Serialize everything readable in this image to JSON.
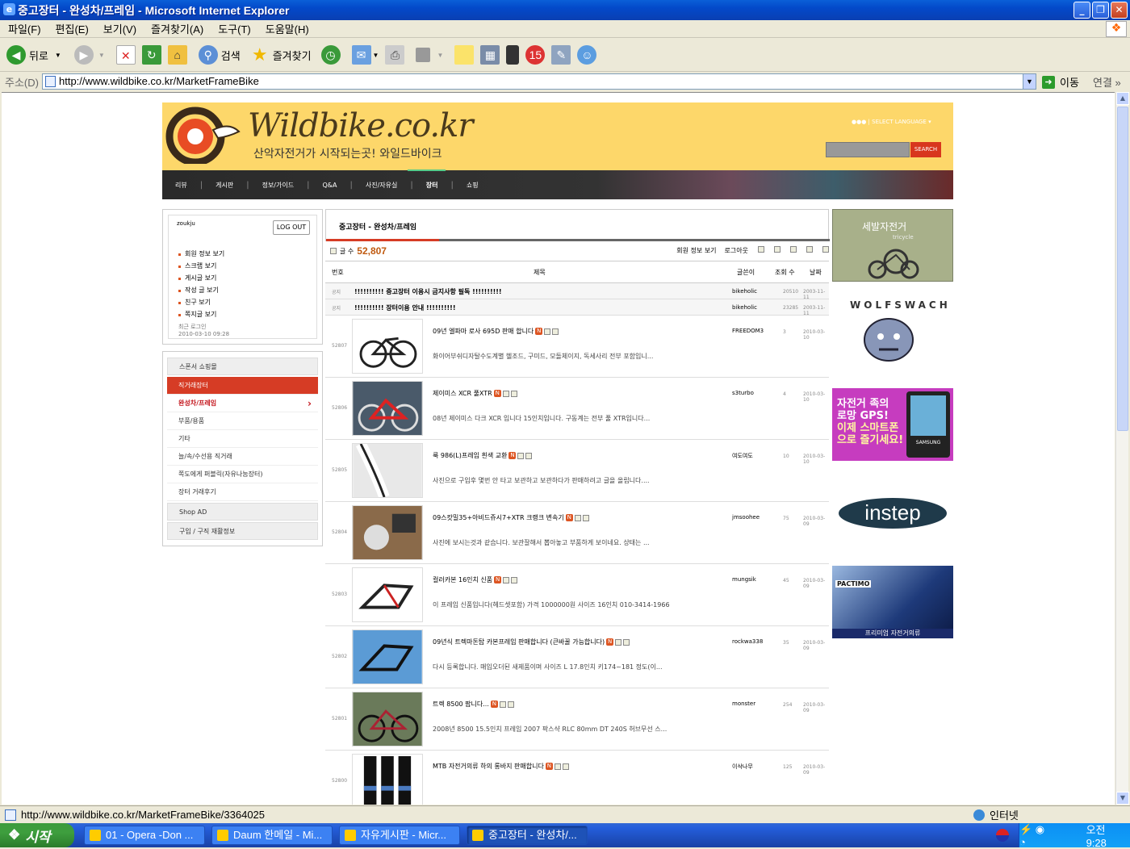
{
  "window": {
    "title": "중고장터 - 완성차/프레임 - Microsoft Internet Explorer",
    "controls": {
      "minimize": "_",
      "restore": "❐",
      "close": "✕"
    }
  },
  "menu": [
    "파일(F)",
    "편집(E)",
    "보기(V)",
    "즐겨찾기(A)",
    "도구(T)",
    "도움말(H)"
  ],
  "toolbar": {
    "back": "뒤로",
    "search": "검색",
    "favorites": "즐겨찾기"
  },
  "address": {
    "label": "주소(D)",
    "url": "http://www.wildbike.co.kr/MarketFrameBike",
    "go": "이동",
    "links": "연결"
  },
  "status": {
    "url": "http://www.wildbike.co.kr/MarketFrameBike/3364025",
    "zone": "인터넷"
  },
  "taskbar": {
    "start": "시작",
    "tasks": [
      "01 - Opera -Don ...",
      "Daum 한메일 - Mi...",
      "자유게시판 - Micr...",
      "중고장터 - 완성차/..."
    ],
    "clock": "오전 9:28"
  },
  "site": {
    "logo": "Wildbike.co.kr",
    "slogan": "산악자전거가 시작되는곳! 와일드바이크",
    "lang_toggle": "●●● | SELECT LANGUAGE ▾",
    "search_button": "SEARCH",
    "nav": [
      "리뷰",
      "게시판",
      "정보/가이드",
      "Q&A",
      "사진/자유실",
      "장터",
      "쇼핑"
    ]
  },
  "login": {
    "user": "zoukju",
    "logout": "LOG OUT",
    "links": [
      "회원 정보 보기",
      "스크랩 보기",
      "게시글 보기",
      "작성 글 보기",
      "친구 보기",
      "쪽지글 보기"
    ],
    "recent_label": "최근 로그인",
    "recent_time": "2010-03-10 09:28"
  },
  "categories": [
    {
      "label": "스폰서 쇼핑몰",
      "style": "head"
    },
    {
      "label": "직거래장터",
      "style": "red"
    },
    {
      "label": "완성차/프레임",
      "style": "redtxt"
    },
    {
      "label": "부품/용품",
      "style": ""
    },
    {
      "label": "기타",
      "style": ""
    },
    {
      "label": "늘/속/수선용 직거래",
      "style": ""
    },
    {
      "label": "쪽도에게 퍼블릭(자유나눔장터)",
      "style": ""
    },
    {
      "label": "장터 거래후기",
      "style": ""
    },
    {
      "label": "Shop AD",
      "style": "head"
    },
    {
      "label": "구입 / 구직 재활정보",
      "style": "head"
    }
  ],
  "board": {
    "tab": "중고장터 - 완성차/프레임",
    "count_label": "글 수",
    "count": "52,807",
    "tools": [
      "회원 정보 보기",
      "로그아웃"
    ],
    "headers": {
      "no": "번호",
      "title": "제목",
      "writer": "글쓴이",
      "views": "조회 수",
      "date": "날짜"
    },
    "notices": [
      {
        "no": "공지",
        "title": "!!!!!!!!!! 중고장터 이용시 금지사항 필독 !!!!!!!!!!",
        "writer": "bikeholic",
        "views": "20510",
        "date": "2003-11-11"
      },
      {
        "no": "공지",
        "title": "!!!!!!!!!! 장터이용 안내 !!!!!!!!!!",
        "writer": "bikeholic",
        "views": "23285",
        "date": "2003-11-11"
      }
    ],
    "items": [
      {
        "no": "52807",
        "title": "09년 엘파마 로사 695D 판매 합니다",
        "sub": "화이어부쉬디자탈수도계별 헬조드, 구미드, 모돌체이지, 독세사리 전부 포함입니...",
        "writer": "FREEDOM3",
        "views": "3",
        "date": "2010-03-10",
        "thumb": "bike-black"
      },
      {
        "no": "52806",
        "title": "제이미스 XCR 풀XTR",
        "sub": "08년 제이미스 다크 XCR 입니다 15인치입니다. 구동계는 전부 풀 XTR입니다...",
        "writer": "s3turbo",
        "views": "4",
        "date": "2010-03-10",
        "thumb": "bike-red"
      },
      {
        "no": "52805",
        "title": "룩 986(L)프레임 흰색 교환",
        "sub": "사진으로 구입후 몇번 안 타고 보관하고 보관하다가 판매하려고 글을 올립니다....",
        "writer": "여도여도",
        "views": "10",
        "date": "2010-03-10",
        "thumb": "frame-white"
      },
      {
        "no": "52804",
        "title": "09스캇밀35+아비드쥬시7+XTR 크랭크 변속기",
        "sub": "사진에 보시는것과 같습니다. 보관잘해서 뽑아놓고 부품하게 보이네요. 상태는 ...",
        "writer": "jmsoohee",
        "views": "75",
        "date": "2010-03-09",
        "thumb": "parts"
      },
      {
        "no": "52803",
        "title": "컬러카본 16인치 신품",
        "sub": "이 프레임 신품입니다(헤드셋포함) 가격 1000000원 사이즈 16인치 010-3414-1966",
        "writer": "mungsik",
        "views": "45",
        "date": "2010-03-09",
        "thumb": "frame-black"
      },
      {
        "no": "52802",
        "title": "09년식 트렉마돈탑 카본프레임 판매합니다 (큰바꿀 가능합니다)",
        "sub": "다시 등록합니다. 매입오더된 새제품이며 사이즈 L 17.8인치 키174~181 정도(이...",
        "writer": "rockwa338",
        "views": "35",
        "date": "2010-03-09",
        "thumb": "frame-blue"
      },
      {
        "no": "52801",
        "title": "트렉 8500 팝니다...",
        "sub": "2008년 8500 15.5인치 프레임 2007 팍스샥 RLC 80mm DT 240S 허브무선 스...",
        "writer": "monster",
        "views": "254",
        "date": "2010-03-09",
        "thumb": "bike-trek"
      },
      {
        "no": "52800",
        "title": "MTB 자전거의류 하의 롱바지 판매합니다",
        "sub": "",
        "writer": "이삭나무",
        "views": "125",
        "date": "2010-03-09",
        "thumb": "pants"
      }
    ]
  },
  "ads": [
    {
      "name": "세발자전거",
      "sub": "tricycle"
    },
    {
      "name": "WOLFSWACH"
    },
    {
      "line1": "자전거 족의",
      "line2": "로망 GPS!",
      "line3": "이제 스마트폰",
      "line4": "으로 즐기세요!",
      "brand": "SAMSUNG"
    },
    {
      "name": "instep"
    },
    {
      "name": "PACTIMO",
      "sub": "프리미엄 자전거의류"
    }
  ]
}
